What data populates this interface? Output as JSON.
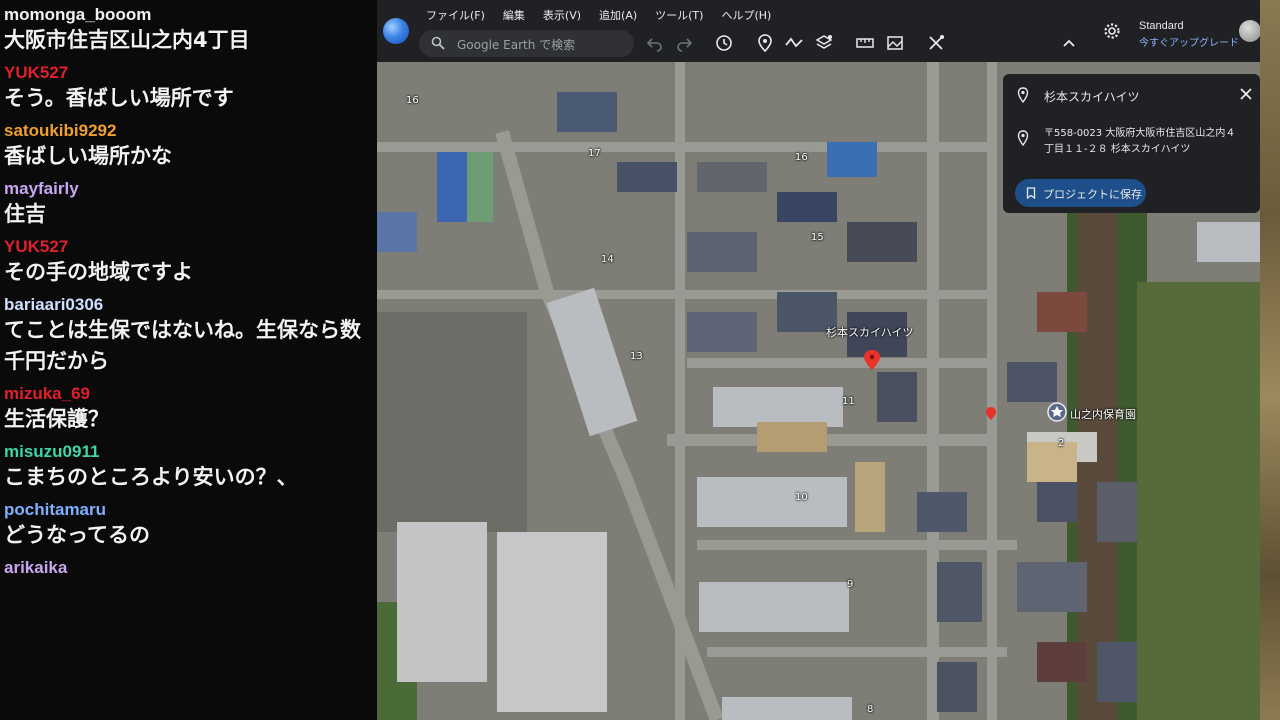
{
  "chat": {
    "messages": [
      {
        "user": "momonga_booom",
        "user_color": "#f2f2f2",
        "text": "大阪市住吉区山之内4丁目"
      },
      {
        "user": "YUK527",
        "user_color": "#e0202c",
        "text": "そう。香ばしい場所です"
      },
      {
        "user": "satoukibi9292",
        "user_color": "#f0a030",
        "text": "香ばしい場所かな"
      },
      {
        "user": "mayfairly",
        "user_color": "#c9a6f2",
        "text": "住吉"
      },
      {
        "user": "YUK527",
        "user_color": "#e0202c",
        "text": "その手の地域ですよ"
      },
      {
        "user": "bariaari0306",
        "user_color": "#cfe0ff",
        "text": "てことは生保ではないね。生保なら数千円だから"
      },
      {
        "user": "mizuka_69",
        "user_color": "#e0202c",
        "text": "生活保護？"
      },
      {
        "user": "misuzu0911",
        "user_color": "#3fd6a8",
        "text": "こまちのところより安いの？、"
      },
      {
        "user": "pochitamaru",
        "user_color": "#7fb0ff",
        "text": "どうなってるの"
      },
      {
        "user": "arikaika",
        "user_color": "#c9a6f2",
        "text": ""
      }
    ]
  },
  "earth": {
    "menu": [
      "ファイル(F)",
      "編集",
      "表示(V)",
      "追加(A)",
      "ツール(T)",
      "ヘルプ(H)"
    ],
    "search_placeholder": "Google Earth で検索",
    "profile": {
      "plan": "Standard",
      "upgrade": "今すぐアップグレード"
    },
    "toolbar_icons": [
      "undo-icon",
      "redo-icon",
      "history-icon",
      "placemark-icon",
      "path-icon",
      "layers-icon",
      "ruler-icon",
      "image-overlay-icon",
      "tools-icon",
      "collapse-icon"
    ]
  },
  "card": {
    "title": "杉本スカイハイツ",
    "address": "〒558-0023 大阪府大阪市住吉区山之内４丁目１１-２８ 杉本スカイハイツ",
    "save_label": "プロジェクトに保存"
  },
  "map": {
    "pin_label": "杉本スカイハイツ",
    "school_label": "山之内保育園",
    "block_numbers": [
      "16",
      "17",
      "16",
      "15",
      "14",
      "13",
      "11",
      "10",
      "9",
      "8",
      "2"
    ]
  },
  "colors": {
    "accent": "#8ab4f8",
    "pin": "#e8332a",
    "save_bg": "#1f4f8a"
  }
}
